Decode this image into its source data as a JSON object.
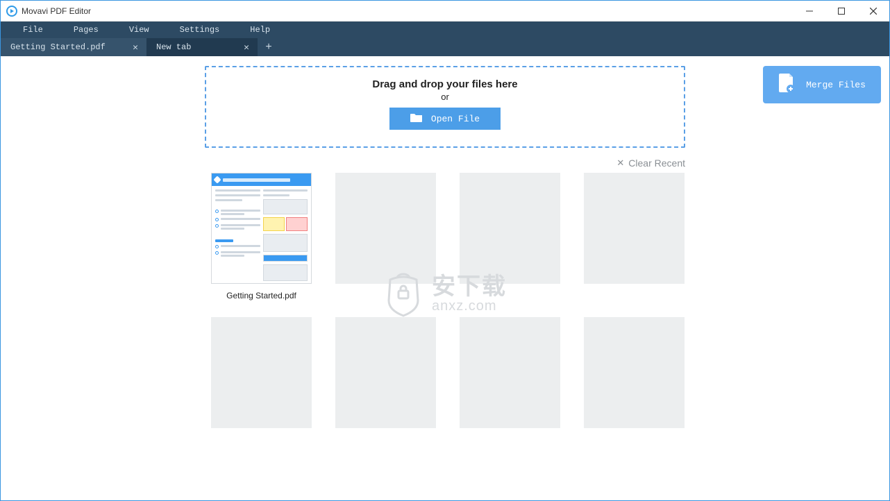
{
  "window": {
    "title": "Movavi PDF Editor"
  },
  "menu": {
    "items": [
      "File",
      "Pages",
      "View",
      "Settings",
      "Help"
    ]
  },
  "tabs": [
    {
      "label": "Getting Started.pdf",
      "active": false
    },
    {
      "label": "New tab",
      "active": true
    }
  ],
  "dropzone": {
    "headline": "Drag and drop your files here",
    "or": "or",
    "open_label": "Open File"
  },
  "merge": {
    "label": "Merge Files"
  },
  "clear_recent": {
    "label": "Clear Recent"
  },
  "recent": {
    "items": [
      {
        "label": "Getting Started.pdf",
        "has_thumb": true
      },
      {
        "label": "",
        "has_thumb": false
      },
      {
        "label": "",
        "has_thumb": false
      },
      {
        "label": "",
        "has_thumb": false
      },
      {
        "label": "",
        "has_thumb": false
      },
      {
        "label": "",
        "has_thumb": false
      },
      {
        "label": "",
        "has_thumb": false
      },
      {
        "label": "",
        "has_thumb": false
      }
    ]
  },
  "watermark": {
    "line1": "安下载",
    "line2": "anxz.com"
  }
}
